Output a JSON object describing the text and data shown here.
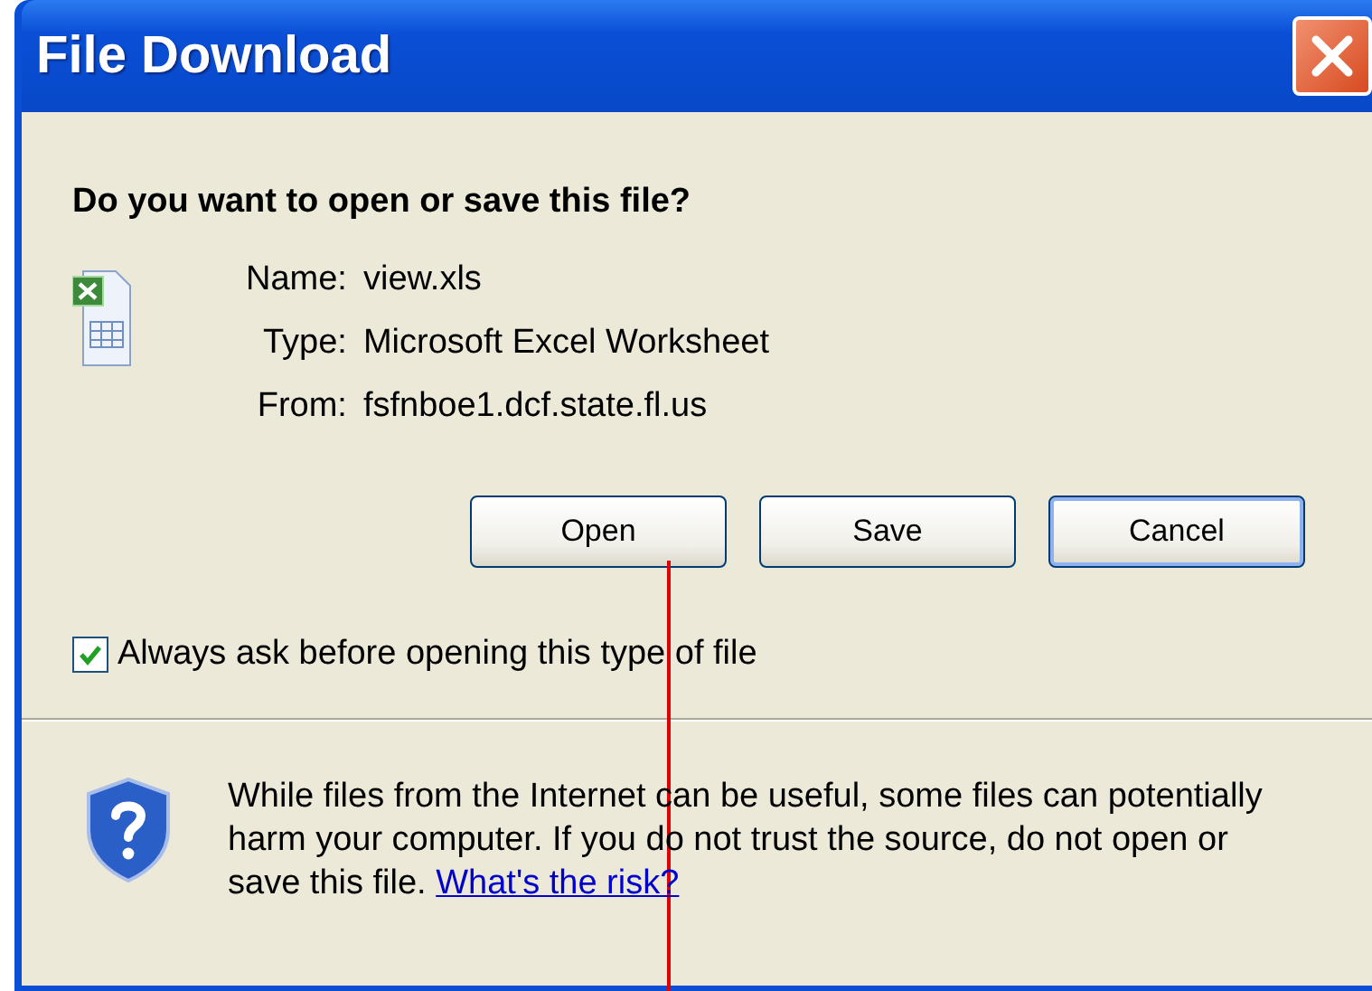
{
  "window": {
    "title": "File Download"
  },
  "question": "Do you want to open or save this file?",
  "file": {
    "fields": [
      {
        "label": "Name:",
        "value": "view.xls"
      },
      {
        "label": "Type:",
        "value": "Microsoft Excel Worksheet"
      },
      {
        "label": "From:",
        "value": "fsfnboe1.dcf.state.fl.us"
      }
    ]
  },
  "buttons": [
    {
      "label": "Open",
      "focused": false
    },
    {
      "label": "Save",
      "focused": false
    },
    {
      "label": "Cancel",
      "focused": true
    }
  ],
  "always_ask": {
    "label": "Always ask before opening this type of file",
    "checked": true
  },
  "warning": {
    "text": "While files from the Internet can be useful, some files can potentially harm your computer. If you do not trust the source, do not open or save this file.",
    "link": "What's the risk?"
  },
  "overlay": {
    "kind": "line"
  }
}
